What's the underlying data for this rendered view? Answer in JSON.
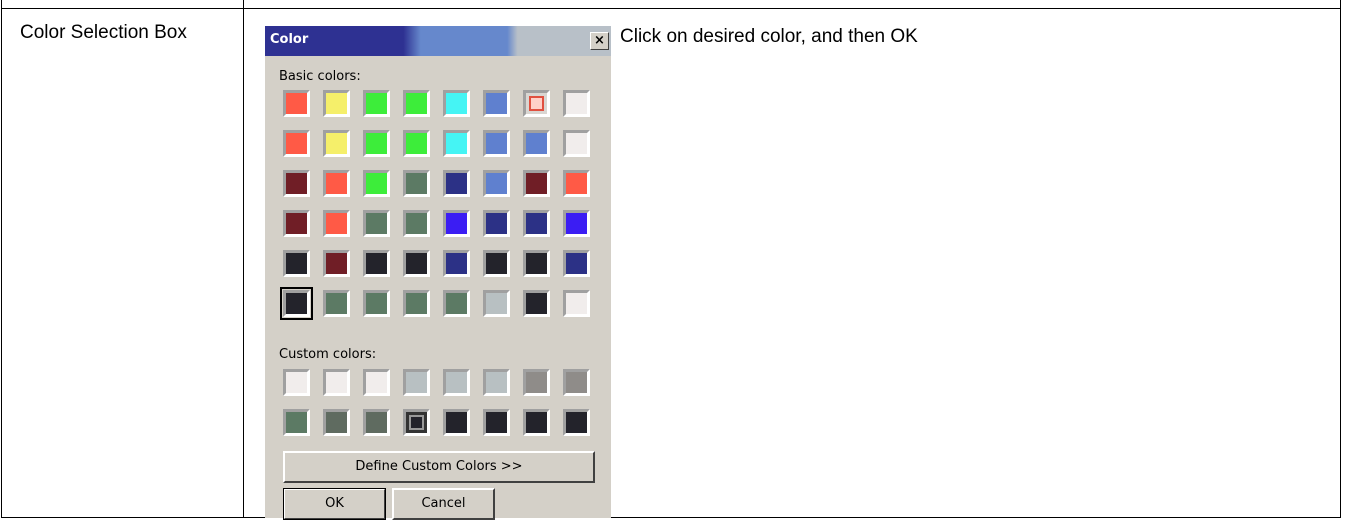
{
  "row": {
    "label": "Color Selection Box",
    "instruction": "Click on desired color, and then OK"
  },
  "dialog": {
    "title": "Color",
    "close_label": "×",
    "basic_label": "Basic colors:",
    "custom_label": "Custom colors:",
    "define_button": "Define Custom Colors >>",
    "ok_button": "OK",
    "cancel_button": "Cancel",
    "basic_colors": [
      [
        "#ff5a46",
        "#f5ef6a",
        "#3ded3a",
        "#3ded3a",
        "#45f4f4",
        "#5f80cf",
        "#ffd0c8",
        "#f1edec"
      ],
      [
        "#ff5a46",
        "#f5ef6a",
        "#3ded3a",
        "#3ded3a",
        "#45f4f4",
        "#5f80cf",
        "#5f80cf",
        "#f1edec"
      ],
      [
        "#701e26",
        "#ff5a46",
        "#3ded3a",
        "#5c7a64",
        "#2c3186",
        "#5f80cf",
        "#701e26",
        "#ff5a46"
      ],
      [
        "#701e26",
        "#ff5a46",
        "#5c7a64",
        "#5c7a64",
        "#3b1df3",
        "#2c3186",
        "#2c3186",
        "#3b1df3"
      ],
      [
        "#23232b",
        "#701e26",
        "#23232b",
        "#23232b",
        "#2c3186",
        "#23232b",
        "#23232b",
        "#2c3186"
      ],
      [
        "#23232b",
        "#5c7a64",
        "#5c7a64",
        "#5c7a64",
        "#5c7a64",
        "#b8c0c2",
        "#23232b",
        "#f1edec"
      ]
    ],
    "custom_colors": [
      [
        "#f1edec",
        "#f1edec",
        "#f1edec",
        "#b8c0c2",
        "#b8c0c2",
        "#b8c0c2",
        "#8f8c89",
        "#8f8c89"
      ],
      [
        "#5c7a64",
        "#5f6b60",
        "#5f6b60",
        "#23232b",
        "#23232b",
        "#23232b",
        "#23232b",
        "#23232b"
      ]
    ],
    "selected_basic": "5-0",
    "boxed_basic": "0-6",
    "boxed_custom": "1-3"
  }
}
